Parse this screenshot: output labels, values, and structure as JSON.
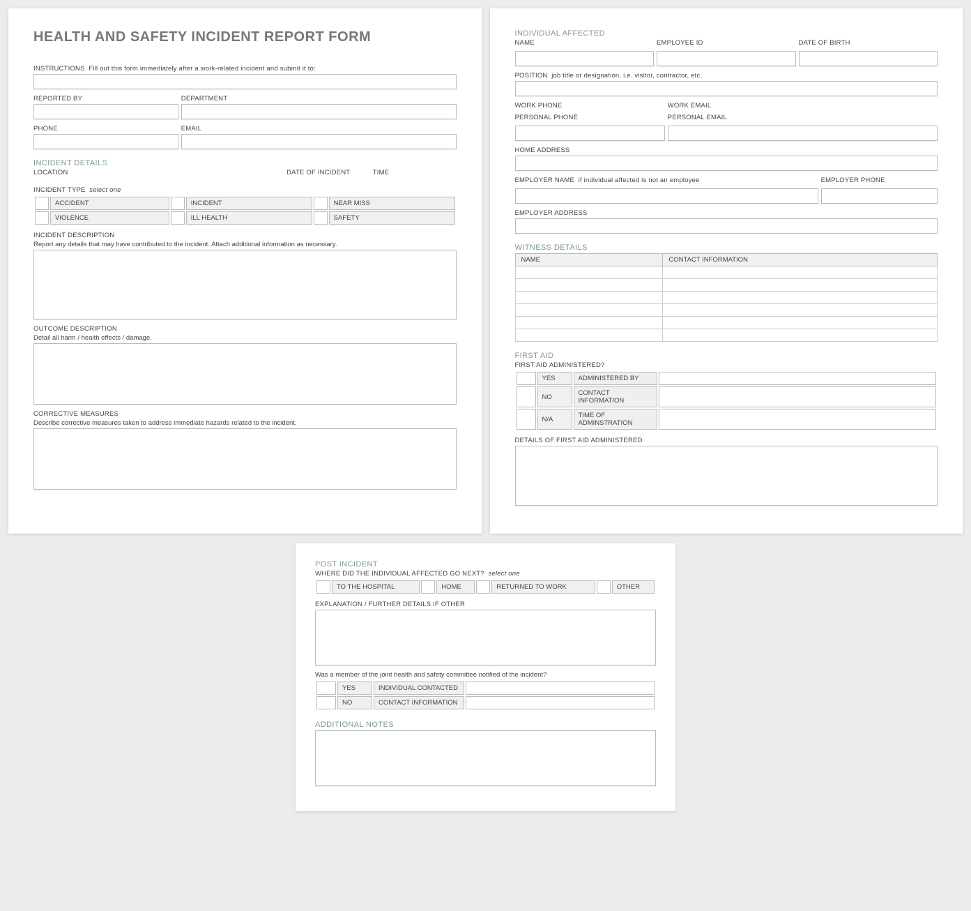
{
  "title": "HEALTH AND SAFETY INCIDENT REPORT FORM",
  "instructions": {
    "label": "INSTRUCTIONS",
    "text": "Fill out this form immediately after a work-related incident and submit it to:"
  },
  "reporter": {
    "reported_by": "REPORTED BY",
    "department": "DEPARTMENT",
    "phone": "PHONE",
    "email": "EMAIL"
  },
  "incident_details": {
    "heading": "INCIDENT DETAILS",
    "location": "LOCATION",
    "date": "DATE OF INCIDENT",
    "time": "TIME",
    "type_label": "INCIDENT TYPE",
    "type_hint": "select one",
    "types": [
      "ACCIDENT",
      "INCIDENT",
      "NEAR MISS",
      "VIOLENCE",
      "ILL HEALTH",
      "SAFETY"
    ],
    "desc_label": "INCIDENT DESCRIPTION",
    "desc_sub": "Report any details that may have contributed to the incident.  Attach additional information as necessary.",
    "outcome_label": "OUTCOME DESCRIPTION",
    "outcome_sub": "Detail all harm / health effects / damage.",
    "corrective_label": "CORRECTIVE MEASURES",
    "corrective_sub": "Describe corrective measures taken to address immediate hazards related to the incident."
  },
  "individual": {
    "heading": "INDIVIDUAL AFFECTED",
    "name": "NAME",
    "employee_id": "EMPLOYEE ID",
    "dob": "DATE OF BIRTH",
    "position_label": "POSITION",
    "position_hint": "job title or designation, i.e. visitor, contractor, etc.",
    "work_phone": "WORK PHONE",
    "work_email": "WORK EMAIL",
    "personal_phone": "PERSONAL PHONE",
    "personal_email": "PERSONAL EMAIL",
    "home_address": "HOME ADDRESS",
    "employer_name_label": "EMPLOYER NAME",
    "employer_name_hint": "if individual affected is not an employee",
    "employer_phone": "EMPLOYER PHONE",
    "employer_address": "EMPLOYER ADDRESS"
  },
  "witness": {
    "heading": "WITNESS DETAILS",
    "cols": [
      "NAME",
      "CONTACT INFORMATION"
    ],
    "rows": 6
  },
  "first_aid": {
    "heading": "FIRST AID",
    "q": "FIRST AID ADMINISTERED?",
    "opts": [
      "YES",
      "NO",
      "N/A"
    ],
    "admin_by": "ADMINISTERED BY",
    "contact": "CONTACT INFORMATION",
    "time": "TIME OF ADMINSTRATION",
    "details": "DETAILS OF FIRST AID ADMINISTERED"
  },
  "post": {
    "heading": "POST INCIDENT",
    "where_label": "WHERE DID THE INDIVIDUAL AFFECTED GO NEXT?",
    "where_hint": "select one",
    "where_opts": [
      "TO THE HOSPITAL",
      "HOME",
      "RETURNED TO WORK",
      "OTHER"
    ],
    "explain": "EXPLANATION / FURTHER DETAILS IF OTHER",
    "committee_q": "Was a member of the joint health and safety committee notified of the incident?",
    "yn": [
      "YES",
      "NO"
    ],
    "ind_contacted": "INDIVIDUAL CONTACTED",
    "contact_info": "CONTACT INFORMATION",
    "notes_heading": "ADDITIONAL NOTES"
  }
}
